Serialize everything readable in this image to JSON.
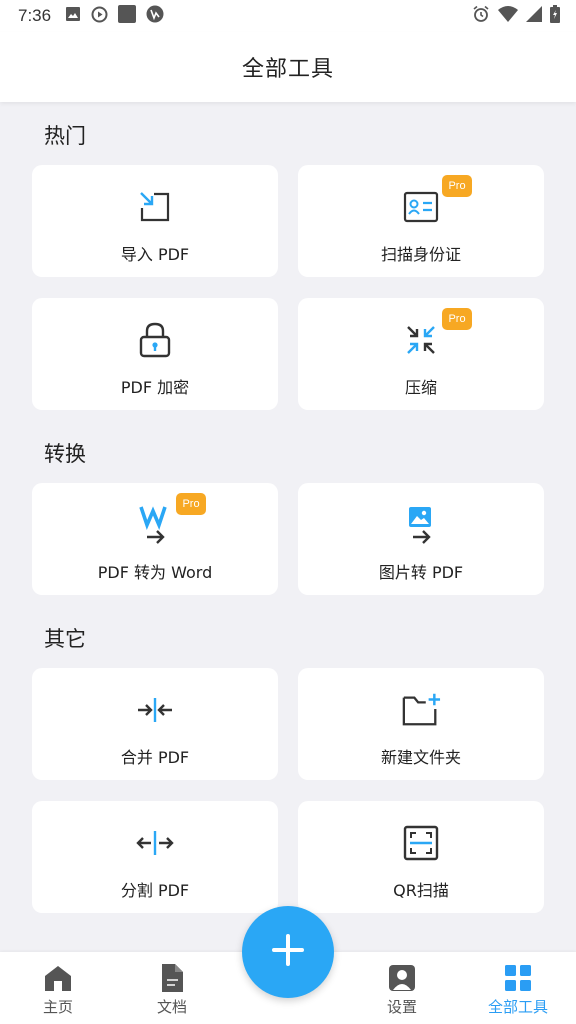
{
  "status_bar": {
    "time": "7:36",
    "left_icons": [
      "image-icon",
      "play-circle-icon",
      "square-icon",
      "browser-icon"
    ],
    "right_icons": [
      "alarm-icon",
      "wifi-icon",
      "signal-icon",
      "battery-icon"
    ]
  },
  "header": {
    "title": "全部工具"
  },
  "sections": {
    "hot": {
      "title": "热门",
      "tools": [
        {
          "label": "导入 PDF",
          "icon": "import-icon",
          "pro": false
        },
        {
          "label": "扫描身份证",
          "icon": "id-card-icon",
          "pro": true,
          "pro_label": "Pro"
        },
        {
          "label": "PDF 加密",
          "icon": "lock-icon",
          "pro": false
        },
        {
          "label": "压缩",
          "icon": "compress-icon",
          "pro": true,
          "pro_label": "Pro"
        }
      ]
    },
    "convert": {
      "title": "转换",
      "tools": [
        {
          "label": "PDF 转为 Word",
          "icon": "word-convert-icon",
          "pro": true,
          "pro_label": "Pro"
        },
        {
          "label": "图片转 PDF",
          "icon": "image-convert-icon",
          "pro": false
        }
      ]
    },
    "other": {
      "title": "其它",
      "tools": [
        {
          "label": "合并 PDF",
          "icon": "merge-icon",
          "pro": false
        },
        {
          "label": "新建文件夹",
          "icon": "new-folder-icon",
          "pro": false
        },
        {
          "label": "分割 PDF",
          "icon": "split-icon",
          "pro": false
        },
        {
          "label": "QR扫描",
          "icon": "qr-scan-icon",
          "pro": false
        }
      ]
    }
  },
  "bottom_nav": {
    "items": [
      {
        "label": "主页",
        "icon": "home-icon",
        "active": false
      },
      {
        "label": "文档",
        "icon": "document-icon",
        "active": false
      },
      {
        "label": "设置",
        "icon": "user-settings-icon",
        "active": false
      },
      {
        "label": "全部工具",
        "icon": "grid-icon",
        "active": true
      }
    ],
    "fab_icon": "plus-icon"
  },
  "colors": {
    "accent": "#2aa7f5",
    "pro_badge": "#f7a823",
    "icon_dark": "#333333",
    "background": "#f1f1f5"
  }
}
